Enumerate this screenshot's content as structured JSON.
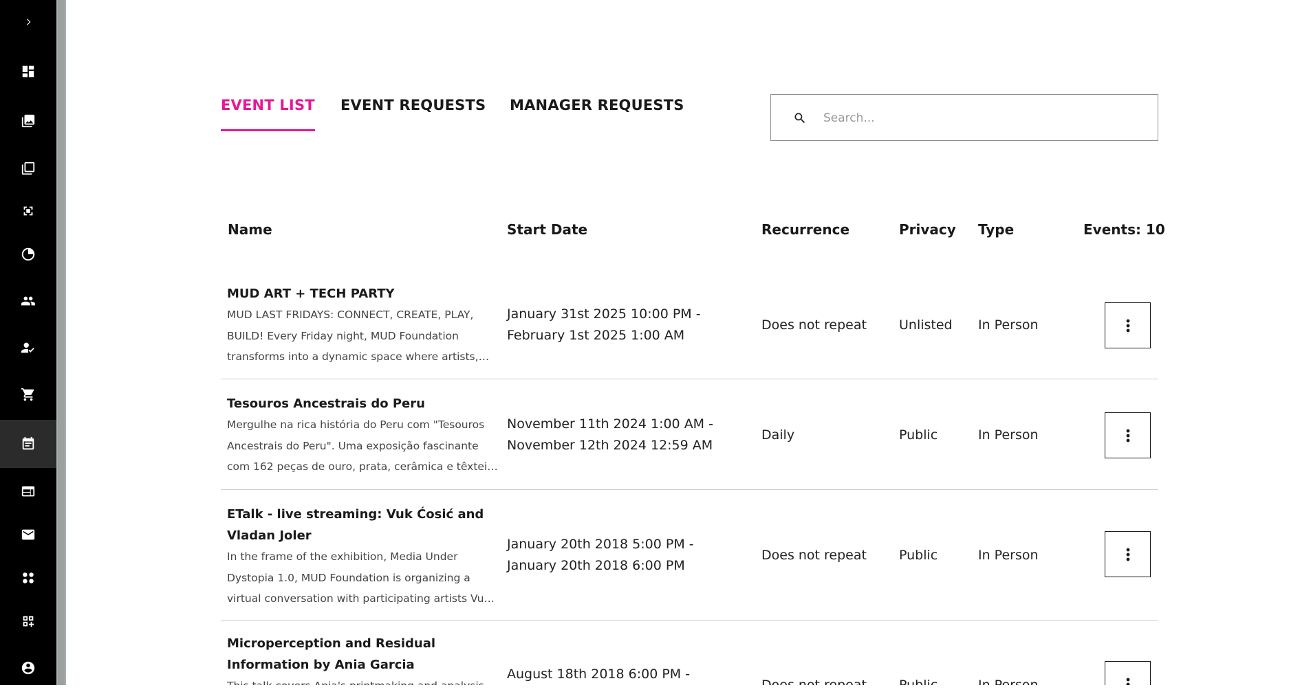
{
  "sidebar": {
    "expand_icon": "chevron-right-icon",
    "items": [
      {
        "icon": "dashboard-icon"
      },
      {
        "icon": "gallery-icon"
      },
      {
        "icon": "collections-icon"
      },
      {
        "icon": "fullscreen-icon"
      },
      {
        "icon": "analytics-icon"
      },
      {
        "icon": "users-icon"
      },
      {
        "icon": "user-check-icon"
      },
      {
        "icon": "cart-icon"
      },
      {
        "icon": "calendar-icon",
        "active": true
      },
      {
        "icon": "browser-icon"
      },
      {
        "icon": "mail-icon"
      },
      {
        "icon": "apps-icon"
      },
      {
        "icon": "add-widget-icon"
      },
      {
        "icon": "account-icon"
      }
    ]
  },
  "tabs": [
    {
      "label": "EVENT LIST",
      "active": true
    },
    {
      "label": "EVENT REQUESTS",
      "active": false
    },
    {
      "label": "MANAGER REQUESTS",
      "active": false
    }
  ],
  "search": {
    "placeholder": "Search...",
    "value": ""
  },
  "table": {
    "headers": {
      "name": "Name",
      "start_date": "Start Date",
      "recurrence": "Recurrence",
      "privacy": "Privacy",
      "type": "Type",
      "events_count": "Events: 10"
    },
    "rows": [
      {
        "title": "MUD ART + TECH PARTY",
        "description": "MUD LAST FRIDAYS: CONNECT, CREATE, PLAY, BUILD! Every Friday night, MUD Foundation transforms into a dynamic space where artists, technologists and creators come together to connect, share and build.",
        "date_line1": "January 31st 2025 10:00 PM -",
        "date_line2": "February 1st 2025 1:00 AM",
        "recurrence": "Does not repeat",
        "privacy": "Unlisted",
        "type": "In Person"
      },
      {
        "title": "Tesouros Ancestrais do Peru",
        "description": "Mergulhe na rica história do Peru com \"Tesouros Ancestrais do Peru\". Uma exposição fascinante com 162 peças de ouro, prata, cerâmica e têxteis que revelam a grandeza das civilizações antigas.",
        "date_line1": "November 11th 2024 1:00 AM -",
        "date_line2": "November 12th 2024 12:59 AM",
        "recurrence": "Daily",
        "privacy": "Public",
        "type": "In Person"
      },
      {
        "title": "ETalk - live streaming: Vuk Ćosić and Vladan Joler",
        "description": "In the frame of the exhibition, Media Under Dystopia 1.0, MUD Foundation is organizing a virtual conversation with participating artists Vuk Ćosić and Vladan Joler about art and technology.",
        "date_line1": "January 20th 2018 5:00 PM -",
        "date_line2": "January 20th 2018 6:00 PM",
        "recurrence": "Does not repeat",
        "privacy": "Public",
        "type": "In Person"
      },
      {
        "title": "Microperception and Residual Information by Ania Garcia",
        "description": "This talk covers Ania's printmaking and analysis",
        "date_line1": "August 18th 2018 6:00 PM -",
        "date_line2": "",
        "recurrence": "Does not repeat",
        "privacy": "Public",
        "type": "In Person"
      }
    ]
  },
  "colors": {
    "accent": "#e5189a",
    "sidebar_bg": "#000000",
    "sidebar_active": "#2b2b2b"
  }
}
